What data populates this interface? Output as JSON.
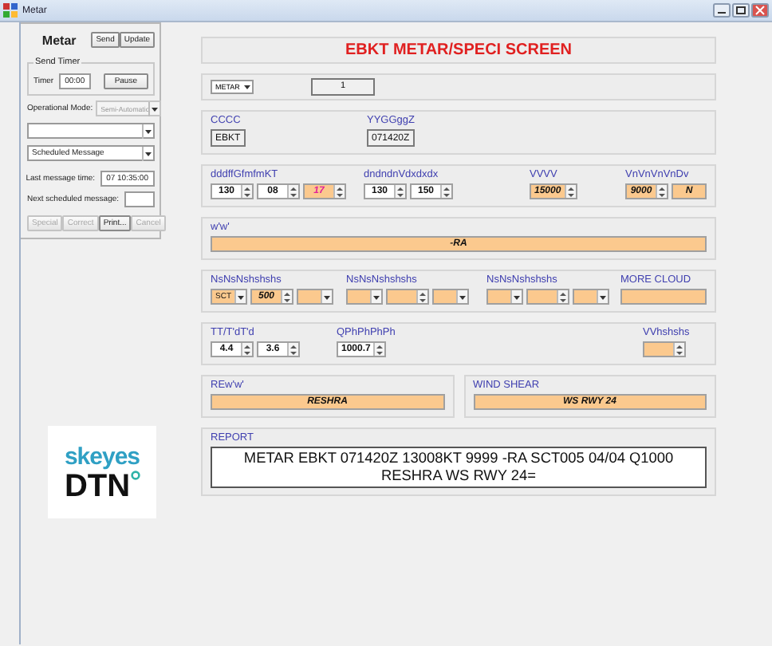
{
  "window": {
    "title": "Metar"
  },
  "left_panel": {
    "title": "Metar",
    "buttons": [
      {
        "label": "Send",
        "disabled": false
      },
      {
        "label": "Update",
        "disabled": false
      }
    ],
    "send_timer": {
      "legend": "Send Timer",
      "label": "Timer",
      "value": "00:00",
      "button": "Pause"
    },
    "operational_mode": {
      "label": "Operational Mode:",
      "value": "Semi-Automatic",
      "disabled": true
    },
    "dropdowns": [
      {
        "disabled": false
      },
      {
        "value": "Scheduled Message",
        "disabled": false
      }
    ],
    "last_message": {
      "label": "Last message time:",
      "value": "07 10:35:00"
    },
    "next_message": {
      "label": "Next scheduled message:"
    },
    "action_buttons": [
      {
        "label": "Special",
        "disabled": true
      },
      {
        "label": "Correct",
        "disabled": true
      },
      {
        "label": "Print...",
        "disabled": false
      },
      {
        "label": "Cancel",
        "disabled": true
      }
    ]
  },
  "logo": {
    "brand": "skeyes",
    "partner": "DTN"
  },
  "main": {
    "title": "EBKT METAR/SPECI SCREEN",
    "message_type": "METAR",
    "counter": "1",
    "rows": [
      {
        "kind": "panel",
        "groups": [
          {
            "label": "CCCC",
            "fields": [
              {
                "kind": "display",
                "value": "EBKT",
                "highlighted": false
              }
            ]
          },
          {
            "label": "YYGGggZ",
            "fields": [
              {
                "kind": "display",
                "value": "071420Z",
                "highlighted": false
              }
            ]
          }
        ]
      },
      {
        "kind": "panel",
        "groups": [
          {
            "label": "dddffGfmfmKT",
            "fields": [
              {
                "kind": "spin",
                "value": "130",
                "highlighted": false
              },
              {
                "kind": "spin",
                "value": "08",
                "highlighted": false
              },
              {
                "kind": "spin",
                "value": "17",
                "highlighted": true,
                "alert": true
              }
            ]
          },
          {
            "label": "dndndnVdxdxdx",
            "fields": [
              {
                "kind": "spin",
                "value": "130",
                "highlighted": false
              },
              {
                "kind": "spin",
                "value": "150",
                "highlighted": false
              }
            ]
          },
          {
            "label": "VVVV",
            "fields": [
              {
                "kind": "spin",
                "value": "15000",
                "highlighted": true
              }
            ]
          },
          {
            "label": "VnVnVnVnDv",
            "fields": [
              {
                "kind": "spin",
                "value": "9000",
                "highlighted": true
              },
              {
                "kind": "box",
                "value": "N",
                "highlighted": true
              }
            ]
          }
        ]
      },
      {
        "kind": "panel",
        "groups": [
          {
            "label": "w'w'",
            "fields": [
              {
                "kind": "box",
                "value": "-RA",
                "highlighted": true
              }
            ]
          }
        ]
      },
      {
        "kind": "panel",
        "groups": [
          {
            "label": "NsNsNshshshs",
            "fields": [
              {
                "kind": "combo",
                "value": "SCT",
                "highlighted": true
              },
              {
                "kind": "spin",
                "value": "500",
                "highlighted": true
              },
              {
                "kind": "combo",
                "highlighted": true
              }
            ]
          },
          {
            "label": "NsNsNshshshs",
            "fields": [
              {
                "kind": "combo",
                "highlighted": true
              },
              {
                "kind": "spin",
                "highlighted": true
              },
              {
                "kind": "combo",
                "highlighted": true
              }
            ]
          },
          {
            "label": "NsNsNshshshs",
            "fields": [
              {
                "kind": "combo",
                "highlighted": true
              },
              {
                "kind": "spin",
                "highlighted": true
              },
              {
                "kind": "combo",
                "highlighted": true
              }
            ]
          },
          {
            "label": "MORE CLOUD",
            "fields": [
              {
                "kind": "box",
                "highlighted": true
              }
            ]
          }
        ]
      },
      {
        "kind": "panel",
        "groups": [
          {
            "label": "TT/T'dT'd",
            "fields": [
              {
                "kind": "spin",
                "value": "4.4",
                "highlighted": false
              },
              {
                "kind": "spin",
                "value": "3.6",
                "highlighted": false
              }
            ]
          },
          {
            "label": "QPhPhPhPh",
            "fields": [
              {
                "kind": "spin",
                "value": "1000.7",
                "highlighted": false
              }
            ]
          },
          {
            "label": "VVhshshs",
            "fields": [
              {
                "kind": "spin",
                "highlighted": true
              }
            ]
          }
        ]
      },
      {
        "kind": "split",
        "groups": [
          {
            "label": "REw'w'",
            "fields": [
              {
                "kind": "box",
                "value": "RESHRA",
                "highlighted": true
              }
            ]
          },
          {
            "label": "WIND SHEAR",
            "fields": [
              {
                "kind": "box",
                "value": "WS RWY 24",
                "highlighted": true
              }
            ]
          }
        ]
      },
      {
        "kind": "report",
        "label": "REPORT",
        "text": "METAR EBKT 071420Z 13008KT 9999 -RA SCT005 04/04 Q1000 RESHRA WS RWY 24="
      }
    ]
  }
}
